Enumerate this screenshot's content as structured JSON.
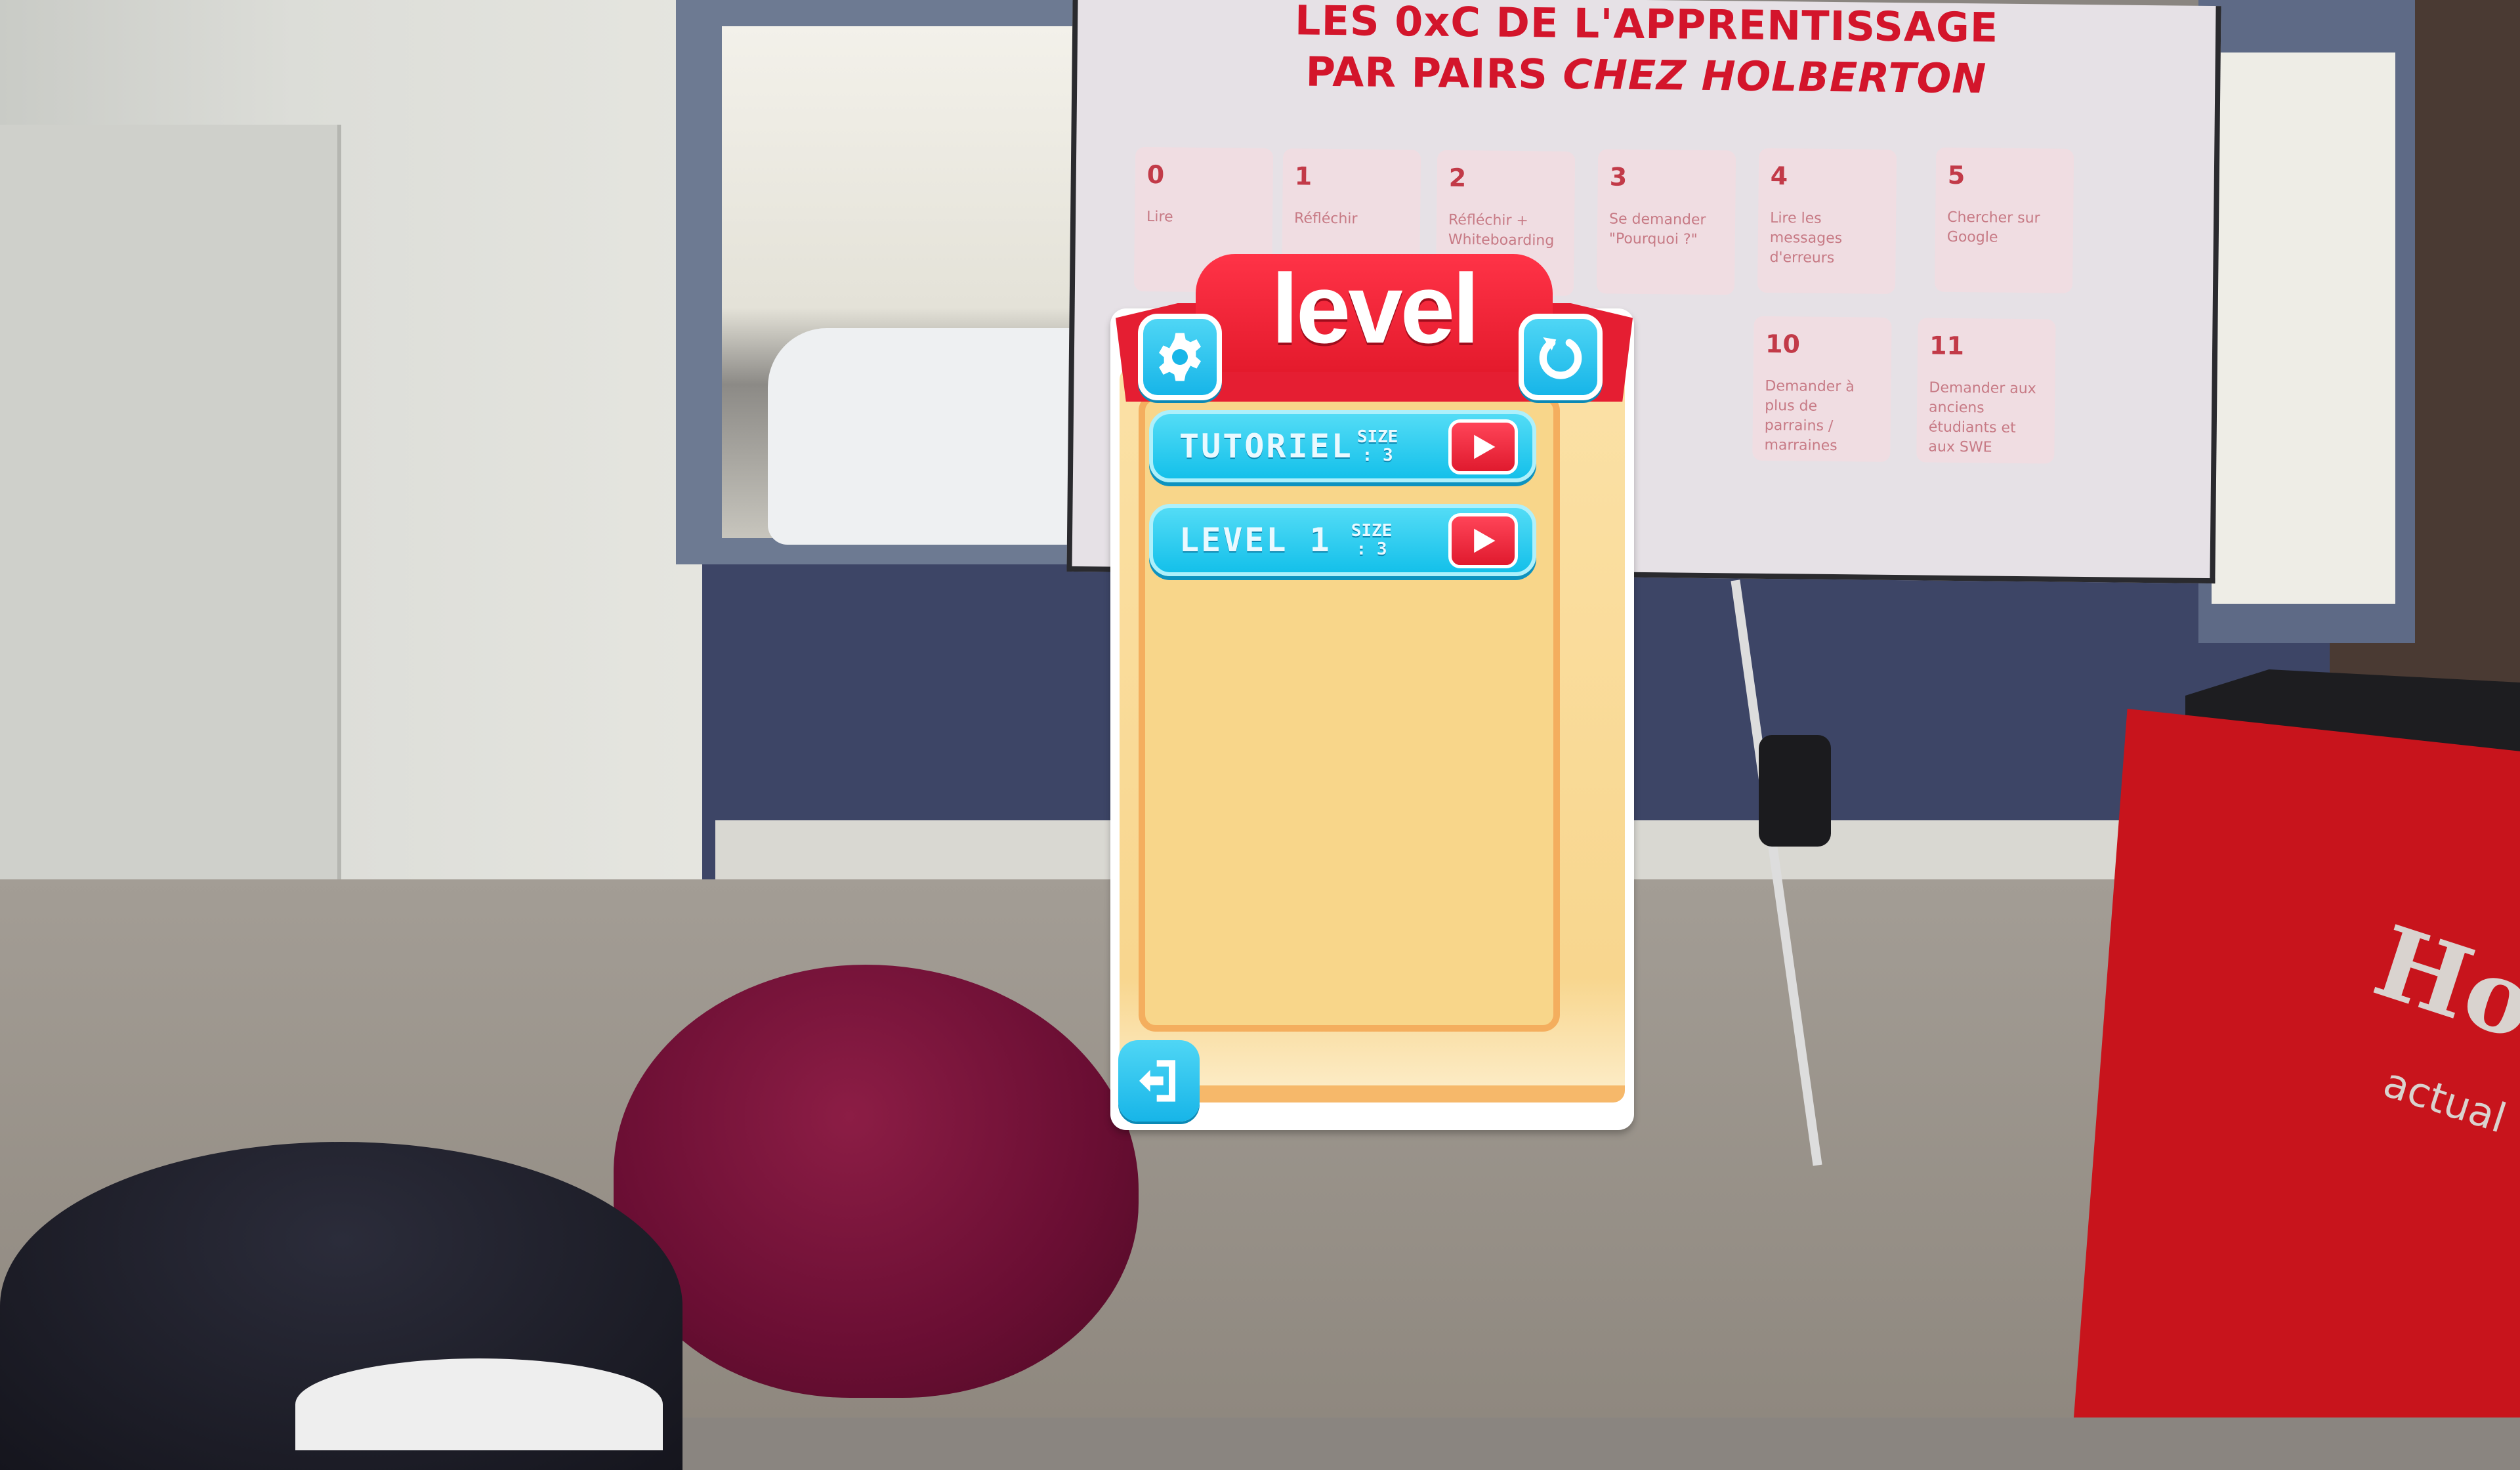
{
  "panel": {
    "title": "level",
    "settings_icon": "gear-icon",
    "refresh_icon": "refresh-icon",
    "exit_icon": "exit-door-icon",
    "levels": [
      {
        "name": "TUTORIEL",
        "size_label": "SIZE",
        "size_value": ": 3"
      },
      {
        "name": "LEVEL 1",
        "size_label": "SIZE",
        "size_value": ": 3"
      }
    ],
    "colors": {
      "banner": "#e51e32",
      "button": "#14c0ea",
      "play": "#e01a2e",
      "panel": "#f8d68a"
    }
  },
  "background": {
    "poster": {
      "title_line1": "LES 0xC DE L'APPRENTISSAGE",
      "title_line2_a": "PAR PAIRS ",
      "title_line2_b": "CHEZ HOLBERTON",
      "cards": [
        {
          "num": "0",
          "text": "Lire"
        },
        {
          "num": "1",
          "text": "Réfléchir"
        },
        {
          "num": "2",
          "text": "Réfléchir + Whiteboarding"
        },
        {
          "num": "3",
          "text": "Se demander \"Pourquoi ?\""
        },
        {
          "num": "4",
          "text": "Lire les messages d'erreurs"
        },
        {
          "num": "5",
          "text": "Chercher sur Google"
        },
        {
          "num": "10",
          "text": "Demander à plus de parrains / marraines"
        },
        {
          "num": "11",
          "text": "Demander aux anciens étudiants et aux SWE"
        }
      ]
    },
    "sign": {
      "logo": "Ho",
      "tagline": "actual"
    }
  }
}
